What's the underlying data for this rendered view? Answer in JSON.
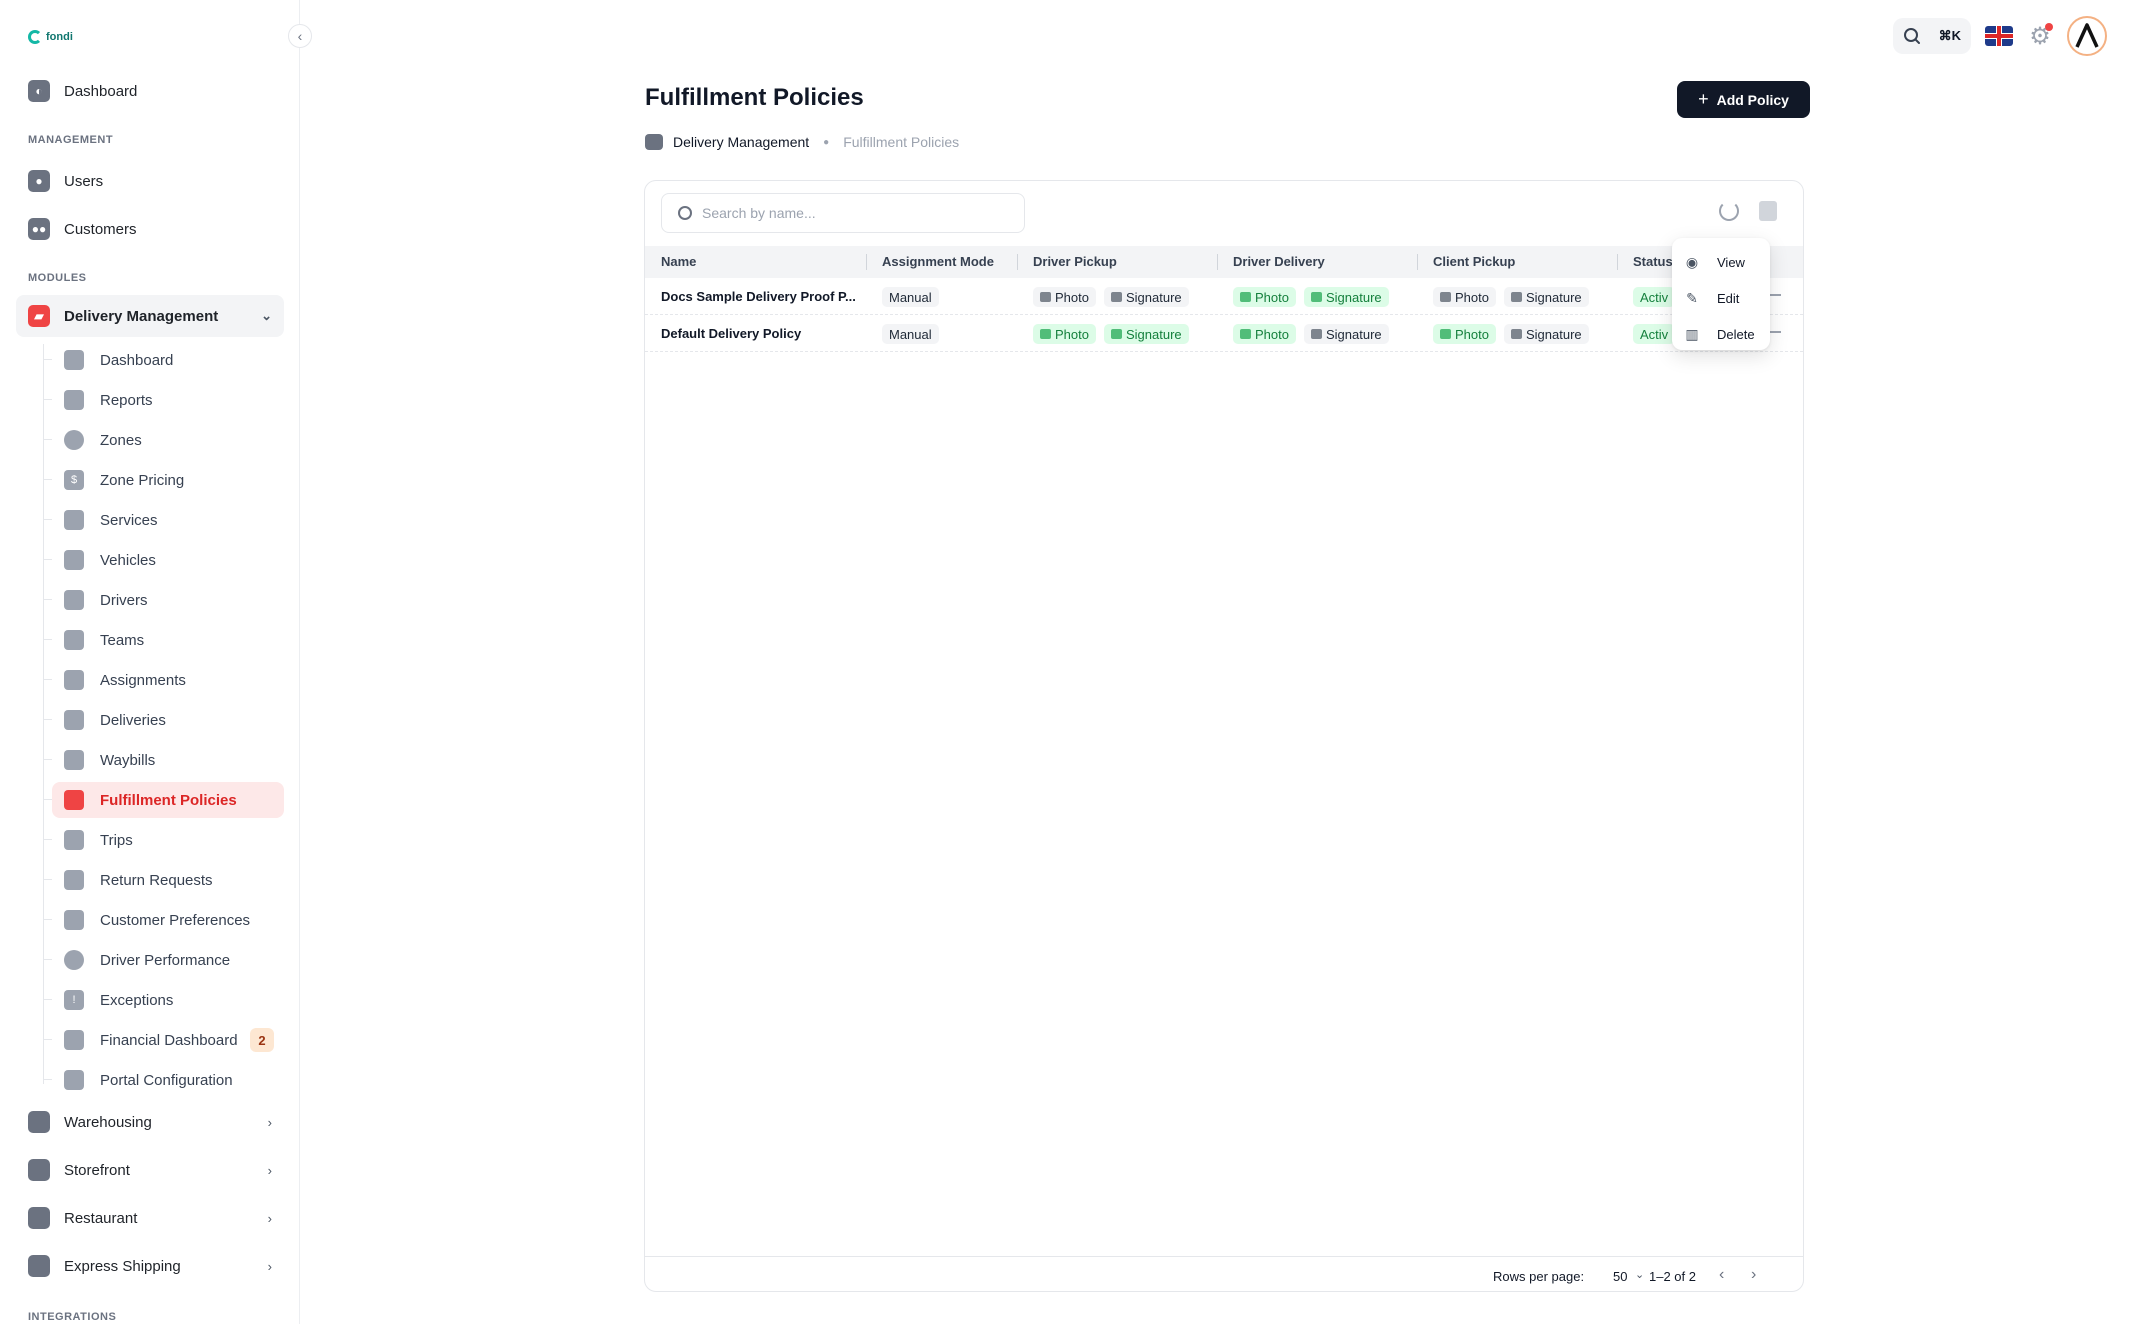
{
  "brand": {
    "name": "fondi",
    "color": "#14b8a6"
  },
  "sidebar": {
    "top_item": {
      "label": "Dashboard",
      "icon": "gauge-icon"
    },
    "sections": {
      "management": "MANAGEMENT",
      "modules": "MODULES",
      "integrations": "INTEGRATIONS"
    },
    "management_items": [
      {
        "label": "Users",
        "icon": "user-icon"
      },
      {
        "label": "Customers",
        "icon": "users-icon"
      }
    ],
    "delivery_management": {
      "label": "Delivery Management",
      "icon": "truck-icon",
      "expanded": true,
      "children": [
        {
          "label": "Dashboard",
          "icon": "gauge-icon"
        },
        {
          "label": "Reports",
          "icon": "chart-icon"
        },
        {
          "label": "Zones",
          "icon": "map-pin-icon"
        },
        {
          "label": "Zone Pricing",
          "icon": "dollar-icon"
        },
        {
          "label": "Services",
          "icon": "user-gear-icon"
        },
        {
          "label": "Vehicles",
          "icon": "scooter-icon"
        },
        {
          "label": "Drivers",
          "icon": "id-card-icon"
        },
        {
          "label": "Teams",
          "icon": "team-icon"
        },
        {
          "label": "Assignments",
          "icon": "clipboard-icon"
        },
        {
          "label": "Deliveries",
          "icon": "delivery-truck-icon"
        },
        {
          "label": "Waybills",
          "icon": "box-icon"
        },
        {
          "label": "Fulfillment Policies",
          "icon": "truck-icon",
          "active": true
        },
        {
          "label": "Trips",
          "icon": "trip-truck-icon"
        },
        {
          "label": "Return Requests",
          "icon": "return-icon"
        },
        {
          "label": "Customer Preferences",
          "icon": "sliders-icon"
        },
        {
          "label": "Driver Performance",
          "icon": "speedometer-icon"
        },
        {
          "label": "Exceptions",
          "icon": "warning-icon"
        },
        {
          "label": "Financial Dashboard",
          "icon": "finance-icon",
          "badge": "2"
        },
        {
          "label": "Portal Configuration",
          "icon": "wrench-icon"
        }
      ]
    },
    "other_modules": [
      {
        "label": "Warehousing",
        "icon": "warehouse-icon"
      },
      {
        "label": "Storefront",
        "icon": "store-icon"
      },
      {
        "label": "Restaurant",
        "icon": "restaurant-icon"
      },
      {
        "label": "Express Shipping",
        "icon": "package-icon"
      }
    ]
  },
  "topbar": {
    "shortcut": "⌘K",
    "language": "en-GB",
    "notification_dot_color": "#ef4444"
  },
  "page": {
    "title": "Fulfillment Policies",
    "add_button": "Add Policy",
    "breadcrumb": [
      "Delivery Management",
      "Fulfillment Policies"
    ]
  },
  "table": {
    "search_placeholder": "Search by name...",
    "columns": [
      "Name",
      "Assignment Mode",
      "Driver Pickup",
      "Driver Delivery",
      "Client Pickup",
      "Status"
    ],
    "rows": [
      {
        "name": "Docs Sample Delivery Proof P...",
        "mode": "Manual",
        "driver_pickup": [
          {
            "label": "Photo",
            "on": false
          },
          {
            "label": "Signature",
            "on": false
          }
        ],
        "driver_delivery": [
          {
            "label": "Photo",
            "on": true
          },
          {
            "label": "Signature",
            "on": true
          }
        ],
        "client_pickup": [
          {
            "label": "Photo",
            "on": false
          },
          {
            "label": "Signature",
            "on": false
          }
        ],
        "status": "Activ"
      },
      {
        "name": "Default Delivery Policy",
        "mode": "Manual",
        "driver_pickup": [
          {
            "label": "Photo",
            "on": true
          },
          {
            "label": "Signature",
            "on": true
          }
        ],
        "driver_delivery": [
          {
            "label": "Photo",
            "on": true
          },
          {
            "label": "Signature",
            "on": false
          }
        ],
        "client_pickup": [
          {
            "label": "Photo",
            "on": true
          },
          {
            "label": "Signature",
            "on": false
          }
        ],
        "status": "Activ"
      }
    ]
  },
  "row_menu": {
    "items": [
      {
        "label": "View",
        "icon": "eye-icon"
      },
      {
        "label": "Edit",
        "icon": "pencil-icon"
      },
      {
        "label": "Delete",
        "icon": "trash-icon"
      }
    ]
  },
  "pagination": {
    "rows_per_page_label": "Rows per page:",
    "rows_per_page": "50",
    "range": "1–2 of 2"
  },
  "colors": {
    "active_nav_bg": "#fde8e8",
    "active_nav_text": "#dc2626",
    "enabled_pill_bg": "#dcfce7",
    "enabled_pill_text": "#15803d",
    "primary_button": "#111827"
  }
}
